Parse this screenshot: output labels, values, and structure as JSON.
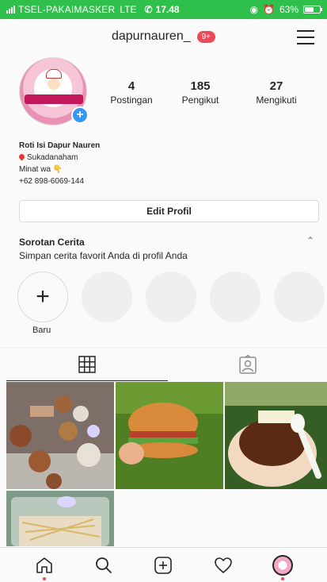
{
  "status_bar": {
    "carrier": "TSEL-PAKAIMASKER",
    "network": "LTE",
    "time": "17.48",
    "battery": "63%",
    "battery_level": 0.63
  },
  "header": {
    "username": "dapurnauren_",
    "notification_badge": "9+"
  },
  "stats": [
    {
      "value": "4",
      "label": "Postingan"
    },
    {
      "value": "185",
      "label": "Pengikut"
    },
    {
      "value": "27",
      "label": "Mengikuti"
    }
  ],
  "bio": {
    "name": "Roti Isi Dapur Nauren",
    "location": "Sukadanaham",
    "line3": "Minat wa 👇",
    "phone": "+62 898-6069-144"
  },
  "edit_profile_label": "Edit Profil",
  "highlights": {
    "title": "Sorotan Cerita",
    "subtitle": "Simpan cerita favorit Anda di profil Anda",
    "new_label": "Baru"
  },
  "icons": {
    "grid": "grid-icon",
    "tagged": "tagged-person-icon",
    "home": "home-icon",
    "search": "search-icon",
    "add": "add-post-icon",
    "activity": "heart-icon",
    "profile": "profile-avatar",
    "menu": "hamburger-menu-icon"
  },
  "colors": {
    "status_bar": "#2fbf4b",
    "badge": "#ed4956",
    "accent_blue": "#3897f0"
  }
}
